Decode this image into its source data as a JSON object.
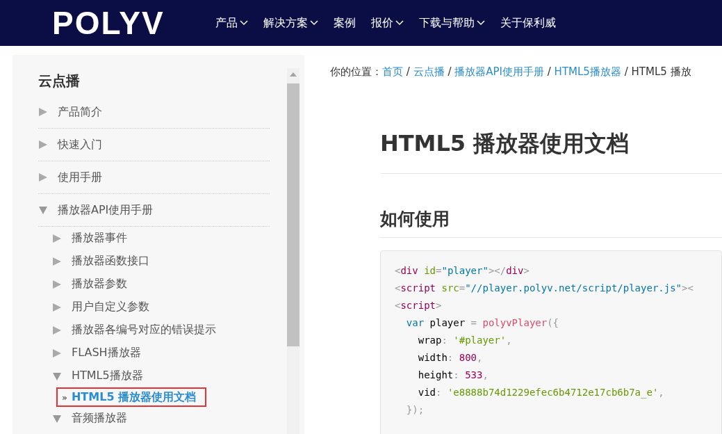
{
  "header": {
    "logo": "POLYV",
    "nav": [
      {
        "label": "产品",
        "dropdown": true
      },
      {
        "label": "解决方案",
        "dropdown": true
      },
      {
        "label": "案例",
        "dropdown": false
      },
      {
        "label": "报价",
        "dropdown": true
      },
      {
        "label": "下载与帮助",
        "dropdown": true
      },
      {
        "label": "关于保利威",
        "dropdown": false
      }
    ]
  },
  "sidebar": {
    "title": "云点播",
    "items": [
      {
        "label": "产品简介",
        "expanded": false
      },
      {
        "label": "快速入门",
        "expanded": false
      },
      {
        "label": "使用手册",
        "expanded": false
      },
      {
        "label": "播放器API使用手册",
        "expanded": true,
        "children": [
          {
            "label": "播放器事件",
            "expanded": false
          },
          {
            "label": "播放器函数接口",
            "expanded": false
          },
          {
            "label": "播放器参数",
            "expanded": false
          },
          {
            "label": "用户自定义参数",
            "expanded": false
          },
          {
            "label": "播放器各编号对应的错误提示",
            "expanded": false
          },
          {
            "label": "FLASH播放器",
            "expanded": false
          },
          {
            "label": "HTML5播放器",
            "expanded": true,
            "children": [
              {
                "label": "»",
                "selected_label": "HTML5 播放器使用文档",
                "selected": true
              }
            ]
          },
          {
            "label": "音频播放器",
            "expanded": true
          }
        ]
      }
    ]
  },
  "breadcrumb": {
    "prefix": "你的位置：",
    "separator": "/",
    "links": [
      "首页",
      "云点播",
      "播放器API使用手册",
      "HTML5播放器"
    ],
    "current": "HTML5 播放"
  },
  "title": "HTML5 播放器使用文档",
  "section": "如何使用",
  "code": [
    [
      {
        "kind": "punct",
        "text": "<"
      },
      {
        "kind": "tag",
        "text": "div "
      },
      {
        "kind": "attr",
        "text": "id"
      },
      {
        "kind": "punct",
        "text": "="
      },
      {
        "kind": "value",
        "text": "\"player\""
      },
      {
        "kind": "punct",
        "text": ">"
      },
      {
        "kind": "punct",
        "text": "</"
      },
      {
        "kind": "tag",
        "text": "div"
      },
      {
        "kind": "punct",
        "text": ">"
      }
    ],
    [
      {
        "kind": "punct",
        "text": "<"
      },
      {
        "kind": "tag",
        "text": "script "
      },
      {
        "kind": "attr",
        "text": "src"
      },
      {
        "kind": "punct",
        "text": "="
      },
      {
        "kind": "value",
        "text": "\"//player.polyv.net/script/player.js\""
      },
      {
        "kind": "punct",
        "text": "><"
      }
    ],
    [
      {
        "kind": "punct",
        "text": "<"
      },
      {
        "kind": "tag",
        "text": "script"
      },
      {
        "kind": "punct",
        "text": ">"
      }
    ],
    [
      {
        "kind": "keyword",
        "text": "  var"
      },
      {
        "kind": "plain",
        "text": " player "
      },
      {
        "kind": "punct",
        "text": "= "
      },
      {
        "kind": "func",
        "text": "polyvPlayer"
      },
      {
        "kind": "punct",
        "text": "({"
      }
    ],
    [
      {
        "kind": "plain",
        "text": "    wrap"
      },
      {
        "kind": "punct",
        "text": ": "
      },
      {
        "kind": "string",
        "text": "'#player'"
      },
      {
        "kind": "punct",
        "text": ","
      }
    ],
    [
      {
        "kind": "plain",
        "text": "    width"
      },
      {
        "kind": "punct",
        "text": ": "
      },
      {
        "kind": "number",
        "text": "800"
      },
      {
        "kind": "punct",
        "text": ","
      }
    ],
    [
      {
        "kind": "plain",
        "text": "    height"
      },
      {
        "kind": "punct",
        "text": ": "
      },
      {
        "kind": "number",
        "text": "533"
      },
      {
        "kind": "punct",
        "text": ","
      }
    ],
    [
      {
        "kind": "plain",
        "text": "    vid"
      },
      {
        "kind": "punct",
        "text": ": "
      },
      {
        "kind": "string",
        "text": "'e8888b74d1229efec6b4712e17cb6b7a_e'"
      },
      {
        "kind": "punct",
        "text": ","
      }
    ],
    [
      {
        "kind": "punct",
        "text": "  });"
      }
    ]
  ]
}
